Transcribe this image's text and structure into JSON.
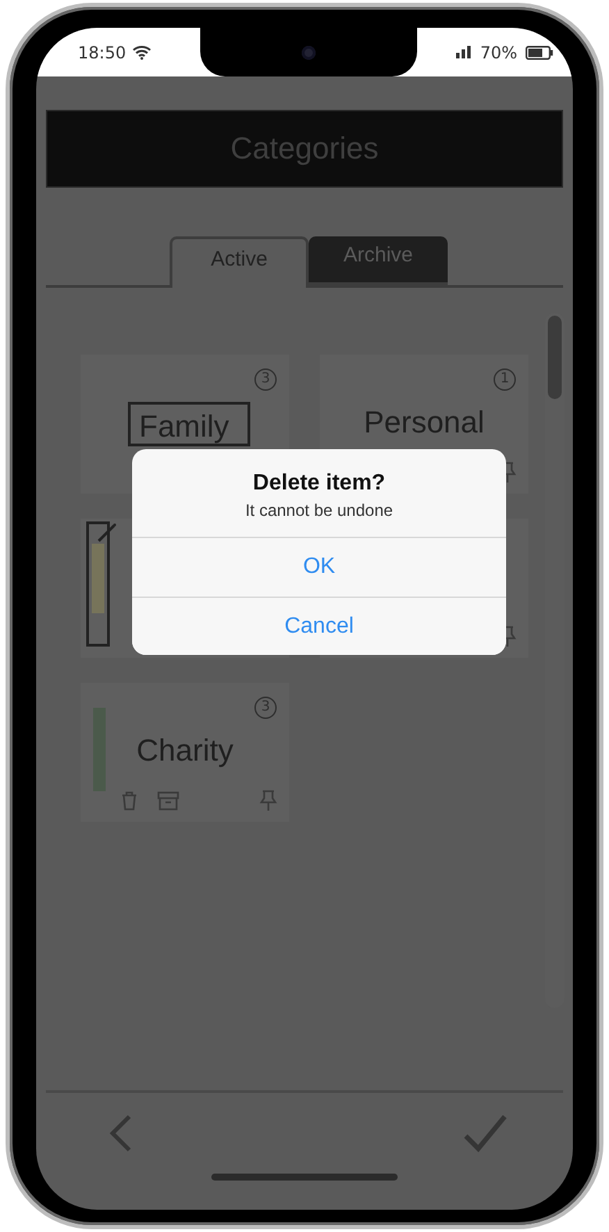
{
  "status_bar": {
    "time": "18:50",
    "battery": "70%"
  },
  "header": {
    "title": "Categories"
  },
  "tabs": [
    {
      "label": "Active",
      "selected": true
    },
    {
      "label": "Archive",
      "selected": false
    }
  ],
  "categories": [
    {
      "label": "Family",
      "count": "3",
      "label_editing": true
    },
    {
      "label": "Personal",
      "count": "1",
      "pin_button": true
    },
    {
      "color": "#77745a",
      "color_editing": true
    },
    {
      "pin_button": true
    },
    {
      "label": "Charity",
      "count": "3",
      "color": "#4b5a4b",
      "delete_button": true,
      "archive_button": true,
      "pin_button": true
    }
  ],
  "dialog": {
    "title": "Delete item?",
    "message": "It cannot be undone",
    "buttons": [
      "OK",
      "Cancel"
    ]
  }
}
